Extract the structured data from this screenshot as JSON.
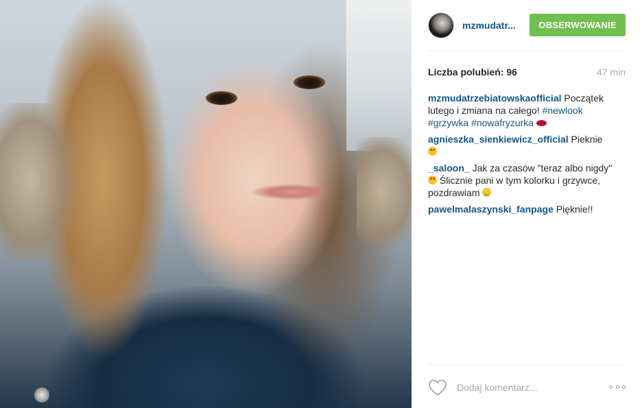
{
  "header": {
    "username": "mzmudatr...",
    "follow_label": "OBSERWOWANIE"
  },
  "stats": {
    "likes_text": "Liczba polubień: 96",
    "time_ago": "47 min"
  },
  "caption": {
    "user": "mzmudatrzebiatowskaofficial",
    "text": " Początek lutego i zmiana na całego! ",
    "tags": [
      "#newlook",
      "#grzywka",
      "#nowafryzurka"
    ],
    "emoji_icon": "lips-icon"
  },
  "comments": [
    {
      "user": "agnieszka_sienkiewicz_official",
      "text": "Pieknie",
      "emoji_icon": "heart-eyes-emoji"
    },
    {
      "user": "_saloon_",
      "text_1": "Jak za czasów \"teraz albo nigdy\"",
      "text_2": "Ślicznie pani w tym kolorku i grzywce, pozdrawiam",
      "emoji_icons": [
        "heart-eyes-emoji",
        "smile-emoji"
      ]
    },
    {
      "user": "pawelmalaszynski_fanpage",
      "text": "Pięknie!!"
    }
  ],
  "footer": {
    "comment_placeholder": "Dodaj komentarz...",
    "like_icon": "heart-outline-icon",
    "more_icon": "more-options-icon"
  },
  "colors": {
    "link": "#125688",
    "follow_button": "#70c050",
    "muted": "#a5a7aa"
  }
}
